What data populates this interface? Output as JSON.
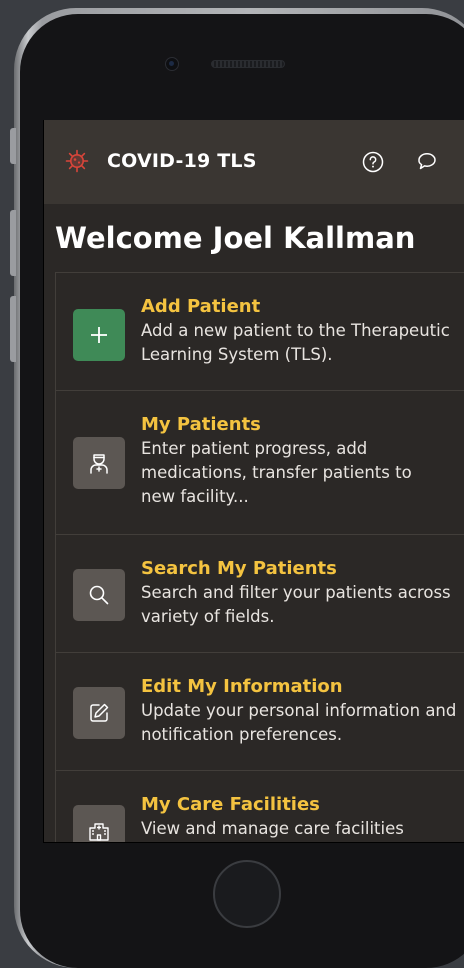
{
  "app": {
    "title": "COVID-19 TLS",
    "logo_icon": "virus-icon",
    "accent": "#f4c340",
    "brand": "#d9453a"
  },
  "header": {
    "help_icon": "help-circle-icon",
    "feedback_icon": "chat-bubble-icon"
  },
  "welcome": "Welcome Joel Kallman",
  "menu": [
    {
      "title": "Add Patient",
      "desc": [
        "Add a new patient to the Therapeutic",
        "Learning System (TLS)."
      ],
      "icon": "plus-icon"
    },
    {
      "title": "My Patients",
      "desc": [
        "Enter patient progress, add",
        "medications, transfer patients to",
        "new facility..."
      ],
      "icon": "doctor-icon"
    },
    {
      "title": "Search My Patients",
      "desc": [
        "Search and filter your patients across",
        "variety of fields."
      ],
      "icon": "search-icon"
    },
    {
      "title": "Edit My Information",
      "desc": [
        "Update your personal information and",
        "notification preferences."
      ],
      "icon": "edit-icon"
    },
    {
      "title": "My Care Facilities",
      "desc": [
        "View and manage care facilities"
      ],
      "icon": "hospital-icon"
    }
  ]
}
